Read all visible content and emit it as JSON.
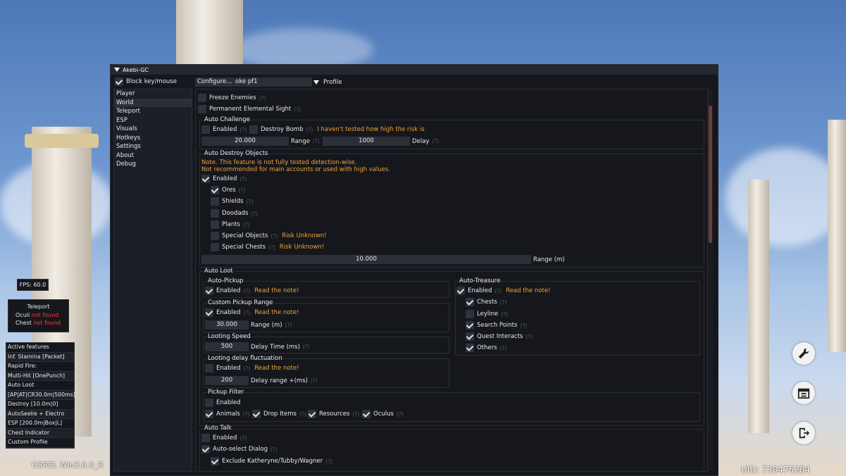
{
  "overlay": {
    "fps": "FPS: 60.0",
    "teleport": {
      "title": "Teleport",
      "oculi_label": "Oculi",
      "oculi_value": "not found",
      "chest_label": "Chest",
      "chest_value": "not found"
    },
    "active_features": [
      "Active features",
      "Inf. Stamina [Packet]",
      "Rapid Fire:",
      "Multi-Hit [OnePunch]",
      "Auto Loot",
      "[AP|AT|CR30.0m|500ms]",
      "Destroy [10.0m|0]",
      "AutoSeelie + Electro",
      "ESP [200.0m|Box|L]",
      "Chest Indicator",
      "Custom Profile"
    ],
    "version": "OSREL Win3.0.0_R",
    "uid": "UID: 730476284"
  },
  "window": {
    "title": "Akebi-GC",
    "block_label": "Block key/mouse",
    "configure_label": "Configure...",
    "profile_value": "oke pf1",
    "profile_label": "Profile"
  },
  "sidebar": [
    "Player",
    "World",
    "Teleport",
    "ESP",
    "Visuals",
    "Hotkeys",
    "Settings",
    "About",
    "Debug"
  ],
  "help": "(?)",
  "world": {
    "freeze_enemies": "Freeze Enemies",
    "perm_elemental_sight": "Permanent Elemental Sight",
    "auto_challenge": {
      "title": "Auto Challenge",
      "enabled": "Enabled",
      "destroy_bomb": "Destroy Bomb",
      "warn": "I haven't tested how high the risk is",
      "range_value": "20.000",
      "range_label": "Range",
      "delay_value": "1000",
      "delay_label": "Delay"
    },
    "auto_destroy": {
      "title": "Auto Destroy Objects",
      "note1": "Note. This feature is not fully tested detection-wise.",
      "note2": "Not recommended for main accounts or used with high values.",
      "enabled": "Enabled",
      "ores": "Ores",
      "shields": "Shields",
      "doodads": "Doodads",
      "plants": "Plants",
      "special_objects": "Special Objects",
      "special_chests": "Special Chests",
      "risk": "Risk Unknown!",
      "range_value": "10.000",
      "range_label": "Range (m)"
    },
    "auto_loot": {
      "title": "Auto Loot",
      "auto_pickup": {
        "title": "Auto-Pickup",
        "enabled": "Enabled",
        "note": "Read the note!"
      },
      "custom_range": {
        "title": "Custom Pickup Range",
        "enabled": "Enabled",
        "note": "Read the note!",
        "value": "30.000",
        "label": "Range (m)"
      },
      "looting_speed": {
        "title": "Looting Speed",
        "value": "500",
        "label": "Delay Time (ms)"
      },
      "delay_fluct": {
        "title": "Looting delay fluctuation",
        "enabled": "Enabled",
        "note": "Read the note!",
        "value": "200",
        "label": "Delay range +(ms)"
      },
      "auto_treasure": {
        "title": "Auto-Treasure",
        "enabled": "Enabled",
        "note": "Read the note!",
        "chests": "Chests",
        "leyline": "Leyline",
        "search_points": "Search Points",
        "quest_interacts": "Quest Interacts",
        "others": "Others"
      },
      "pickup_filter": {
        "title": "Pickup Filter",
        "enabled": "Enabled",
        "animals": "Animals",
        "drop_items": "Drop Items",
        "resources": "Resources",
        "oculus": "Oculus"
      }
    },
    "auto_talk": {
      "title": "Auto Talk",
      "enabled": "Enabled",
      "auto_select": "Auto-select Dialog",
      "exclude": "Exclude Katheryne/Tubby/Wagner"
    }
  }
}
